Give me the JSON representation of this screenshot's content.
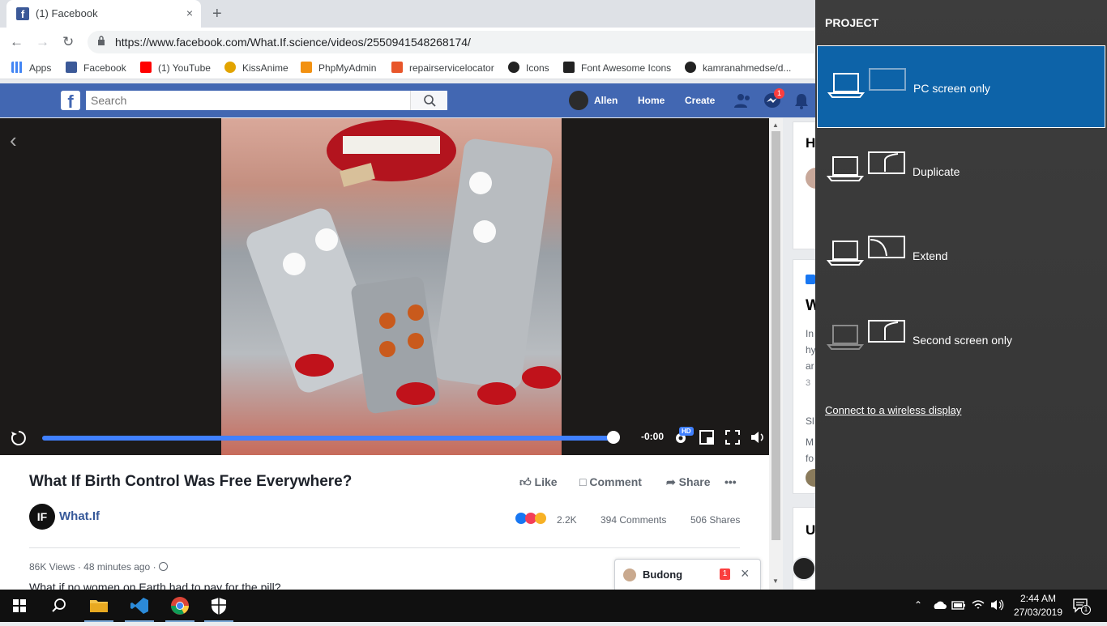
{
  "browser": {
    "tab_title": "(1) Facebook",
    "tab_close": "×",
    "new_tab": "+",
    "url": "https://www.facebook.com/What.If.science/videos/2550941548268174/"
  },
  "bookmarks": [
    {
      "label": "Apps",
      "color": "#4285f4"
    },
    {
      "label": "Facebook",
      "color": "#3b5998"
    },
    {
      "label": "(1) YouTube",
      "color": "#ff0000"
    },
    {
      "label": "KissAnime",
      "color": "#e2a400"
    },
    {
      "label": "PhpMyAdmin",
      "color": "#f29111"
    },
    {
      "label": "repairservicelocator",
      "color": "#e8562a"
    },
    {
      "label": "Icons",
      "color": "#222222"
    },
    {
      "label": "Font Awesome Icons",
      "color": "#222222"
    },
    {
      "label": "kamranahmedse/d...",
      "color": "#222222"
    }
  ],
  "facebook": {
    "logo": "f",
    "search_placeholder": "Search",
    "nav": {
      "user": "Allen",
      "home": "Home",
      "create": "Create"
    },
    "messages_badge": "1",
    "brand_color": "#4267b2"
  },
  "video": {
    "time": "-0:00",
    "quality_badge": "HD",
    "progress_fraction": 1.0
  },
  "post": {
    "title": "What If Birth Control Was Free Everywhere?",
    "actions": {
      "like": "Like",
      "comment": "Comment",
      "share": "Share",
      "more": "•••"
    },
    "page_badge": "IF",
    "page_name": "What.If",
    "reactions_count": "2.2K",
    "comments": "394 Comments",
    "shares": "506 Shares",
    "views": "86K Views",
    "time_ago": "48 minutes ago",
    "meta_sep": "·",
    "description": "What if no women on Earth had to pay for the pill?"
  },
  "chat": {
    "name": "Budong",
    "unread": "1",
    "close": "×"
  },
  "rightcol": {
    "letters": [
      "H",
      "W",
      "In",
      "hy",
      "ar",
      "3",
      "Sl",
      "M",
      "fo",
      "U"
    ]
  },
  "project_panel": {
    "title": "PROJECT",
    "options": [
      {
        "label": "PC screen only",
        "selected": true
      },
      {
        "label": "Duplicate",
        "selected": false
      },
      {
        "label": "Extend",
        "selected": false
      },
      {
        "label": "Second screen only",
        "selected": false
      }
    ],
    "wireless_link": "Connect to a wireless display",
    "accent": "#0d63a8"
  },
  "taskbar": {
    "clock_time": "2:44 AM",
    "clock_date": "27/03/2019",
    "notification_count": "1"
  }
}
